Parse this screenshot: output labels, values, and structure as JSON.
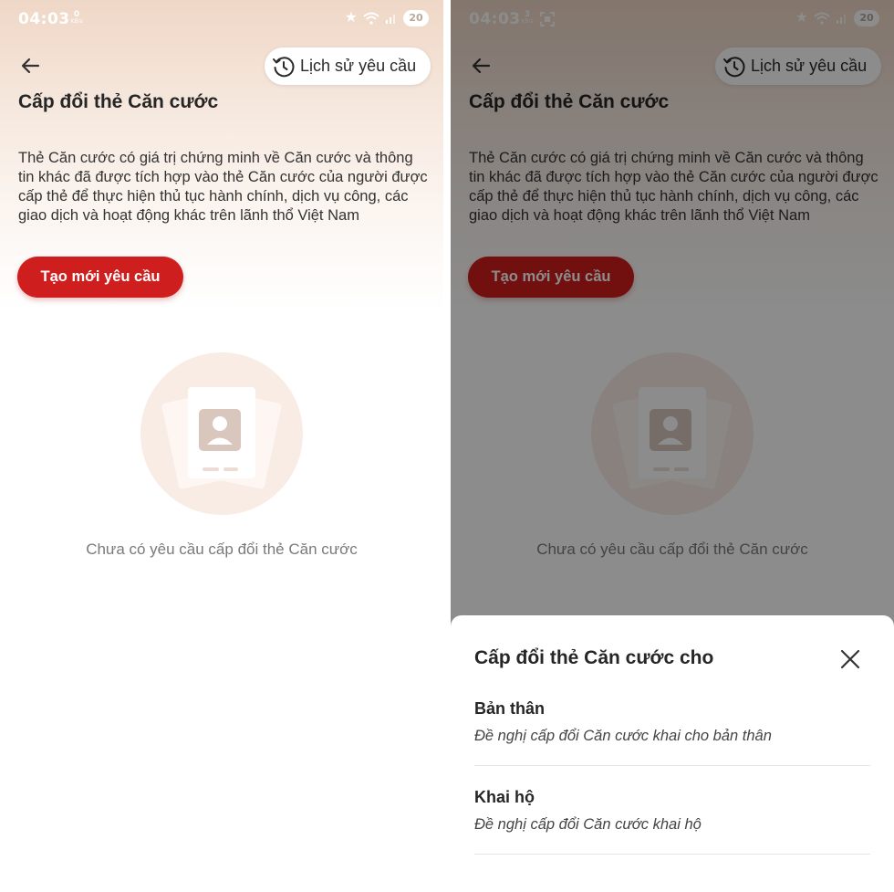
{
  "left_screen": {
    "status_bar": {
      "time": "04:03",
      "net_speed": "0",
      "net_unit": "KB/s",
      "battery": "20"
    },
    "history_button": "Lịch sử yêu cầu",
    "title": "Cấp đổi thẻ Căn cước",
    "description": "Thẻ Căn cước có giá trị chứng minh về Căn cước và thông tin khác đã được tích hợp vào thẻ Căn cước của người được cấp thẻ để thực hiện thủ tục hành chính, dịch vụ công, các giao dịch và hoạt động khác trên lãnh thổ Việt Nam",
    "create_button": "Tạo mới yêu cầu",
    "empty_state": "Chưa có yêu cầu cấp đổi thẻ Căn cước"
  },
  "right_screen": {
    "status_bar": {
      "time": "04:03",
      "net_speed": "3",
      "net_unit": "KB/s",
      "battery": "20"
    },
    "history_button": "Lịch sử yêu cầu",
    "title": "Cấp đổi thẻ Căn cước",
    "description": "Thẻ Căn cước có giá trị chứng minh về Căn cước và thông tin khác đã được tích hợp vào thẻ Căn cước của người được cấp thẻ để thực hiện thủ tục hành chính, dịch vụ công, các giao dịch và hoạt động khác trên lãnh thổ Việt Nam",
    "create_button": "Tạo mới yêu cầu",
    "empty_state": "Chưa có yêu cầu cấp đổi thẻ Căn cước",
    "bottom_sheet": {
      "title": "Cấp đổi thẻ Căn cước cho",
      "options": [
        {
          "title": "Bản thân",
          "description": "Đề nghị cấp đổi Căn cước khai cho bản thân"
        },
        {
          "title": "Khai hộ",
          "description": "Đề nghị cấp đổi Căn cước khai hộ"
        }
      ]
    }
  },
  "icons": [
    "back-arrow-icon",
    "history-clock-icon",
    "star-icon",
    "wifi-icon",
    "signal-icon",
    "screenshot-icon",
    "id-card-icon",
    "close-icon"
  ],
  "colors": {
    "primary_red": "#cf1e1e",
    "header_gradient_top": "#efd7c6",
    "text_dark": "#262626",
    "text_muted": "#7a7a7a"
  }
}
